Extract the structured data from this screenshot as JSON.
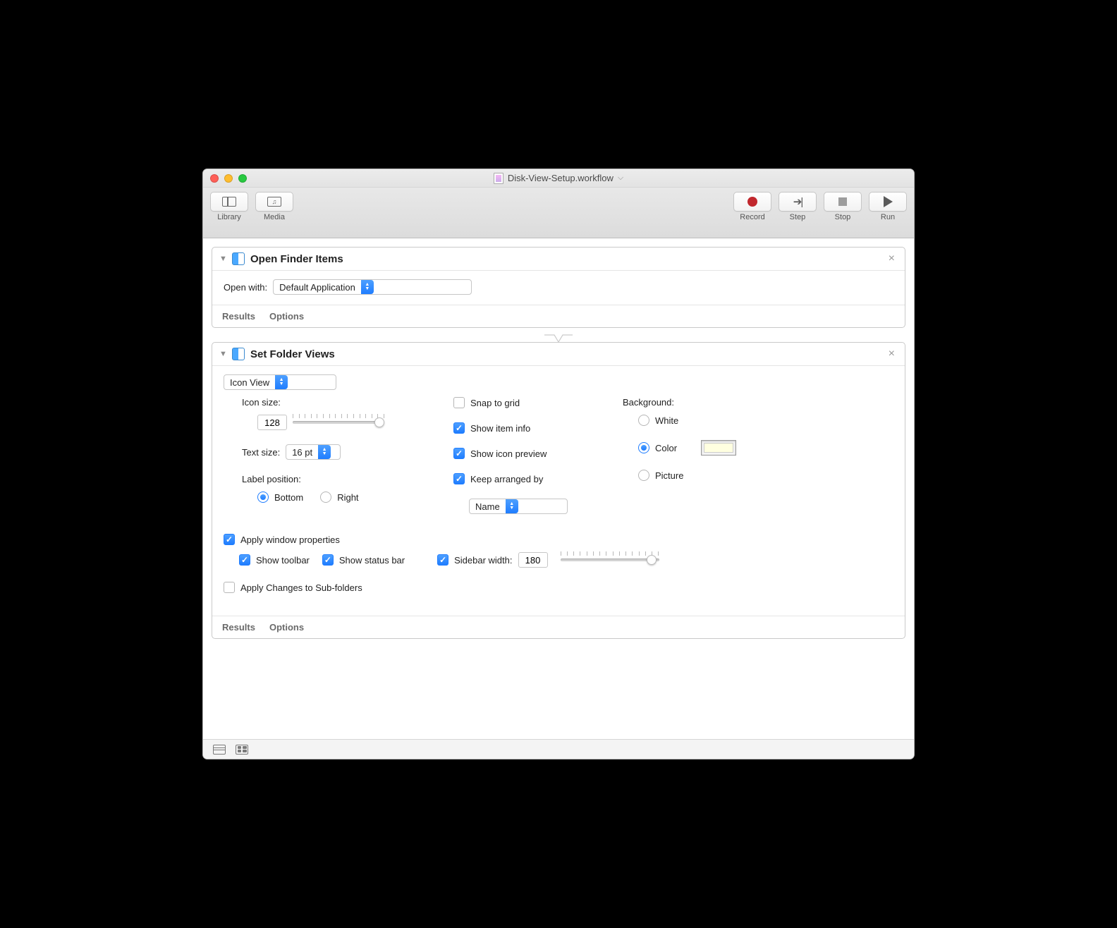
{
  "window": {
    "title": "Disk-View-Setup.workflow"
  },
  "toolbar": {
    "library_label": "Library",
    "media_label": "Media",
    "record_label": "Record",
    "step_label": "Step",
    "stop_label": "Stop",
    "run_label": "Run"
  },
  "action_open_finder": {
    "title": "Open Finder Items",
    "open_with_label": "Open with:",
    "open_with_value": "Default Application",
    "results_tab": "Results",
    "options_tab": "Options"
  },
  "action_set_folder": {
    "title": "Set Folder Views",
    "view_mode_value": "Icon View",
    "icon_size_label": "Icon size:",
    "icon_size_value": "128",
    "text_size_label": "Text size:",
    "text_size_value": "16 pt",
    "label_position_label": "Label position:",
    "label_pos_bottom": "Bottom",
    "label_pos_right": "Right",
    "snap_grid_label": "Snap to grid",
    "show_item_info_label": "Show item info",
    "show_icon_preview_label": "Show icon preview",
    "keep_arranged_label": "Keep arranged by",
    "arrange_by_value": "Name",
    "background_label": "Background:",
    "bg_white": "White",
    "bg_color": "Color",
    "bg_picture": "Picture",
    "bg_color_value": "#ffffe0",
    "apply_window_props_label": "Apply window properties",
    "show_toolbar_label": "Show toolbar",
    "show_status_bar_label": "Show status bar",
    "sidebar_width_label": "Sidebar width:",
    "sidebar_width_value": "180",
    "apply_subfolders_label": "Apply Changes to Sub-folders",
    "results_tab": "Results",
    "options_tab": "Options"
  }
}
